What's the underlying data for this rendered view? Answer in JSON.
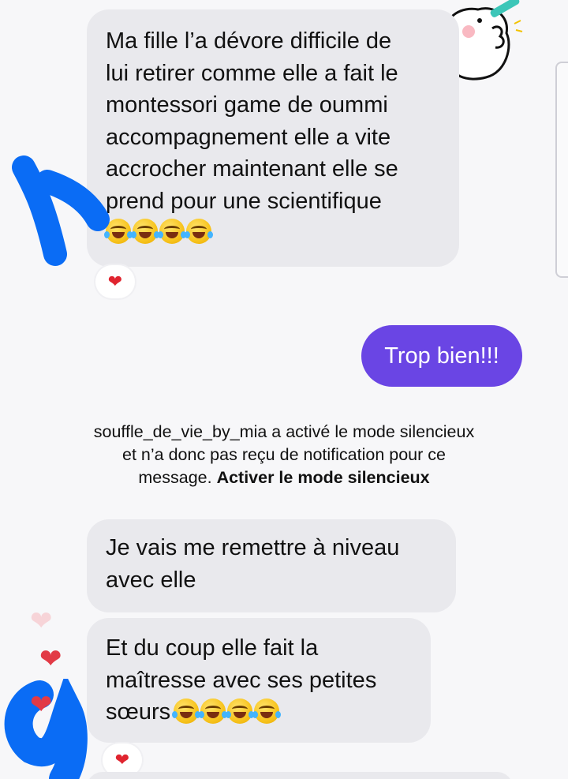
{
  "conversation": {
    "message_1": {
      "lines": [
        "Ma fille l’a dévore difficile de",
        "lui retirer comme elle a fait le",
        "montessori game de oummi",
        "accompagnement elle a vite",
        "accrocher maintenant elle se",
        "prend pour une scientifique"
      ],
      "emoji": "face-with-tears-of-joy x4",
      "reaction": "❤"
    },
    "message_2_sent": {
      "text": "Trop bien!!!"
    },
    "system_notice": {
      "line_1": "souffle_de_vie_by_mia a activé le mode silencieux",
      "line_2": "et n’a donc pas reçu de notification pour ce",
      "line_3_prefix": "message. ",
      "action_label": "Activer le mode silencieux"
    },
    "message_3": {
      "lines": [
        "Je vais me remettre à niveau",
        "avec elle"
      ]
    },
    "message_4": {
      "lines": [
        "Et du coup elle fait la",
        "maîtresse avec ses petites",
        "sœurs"
      ],
      "emoji": "face-with-tears-of-joy x4",
      "reaction": "❤"
    },
    "side_hearts": [
      "❤",
      "❤",
      "❤"
    ]
  },
  "colors": {
    "received_bubble": "#e9e9ed",
    "sent_bubble": "#6a45e4",
    "reaction_heart": "#e0242f",
    "scribble": "#0a6cf5",
    "background": "#f7f7f9"
  },
  "icons": [
    "bear-sticker-icon",
    "face-with-tears-of-joy-icon",
    "heart-icon"
  ]
}
